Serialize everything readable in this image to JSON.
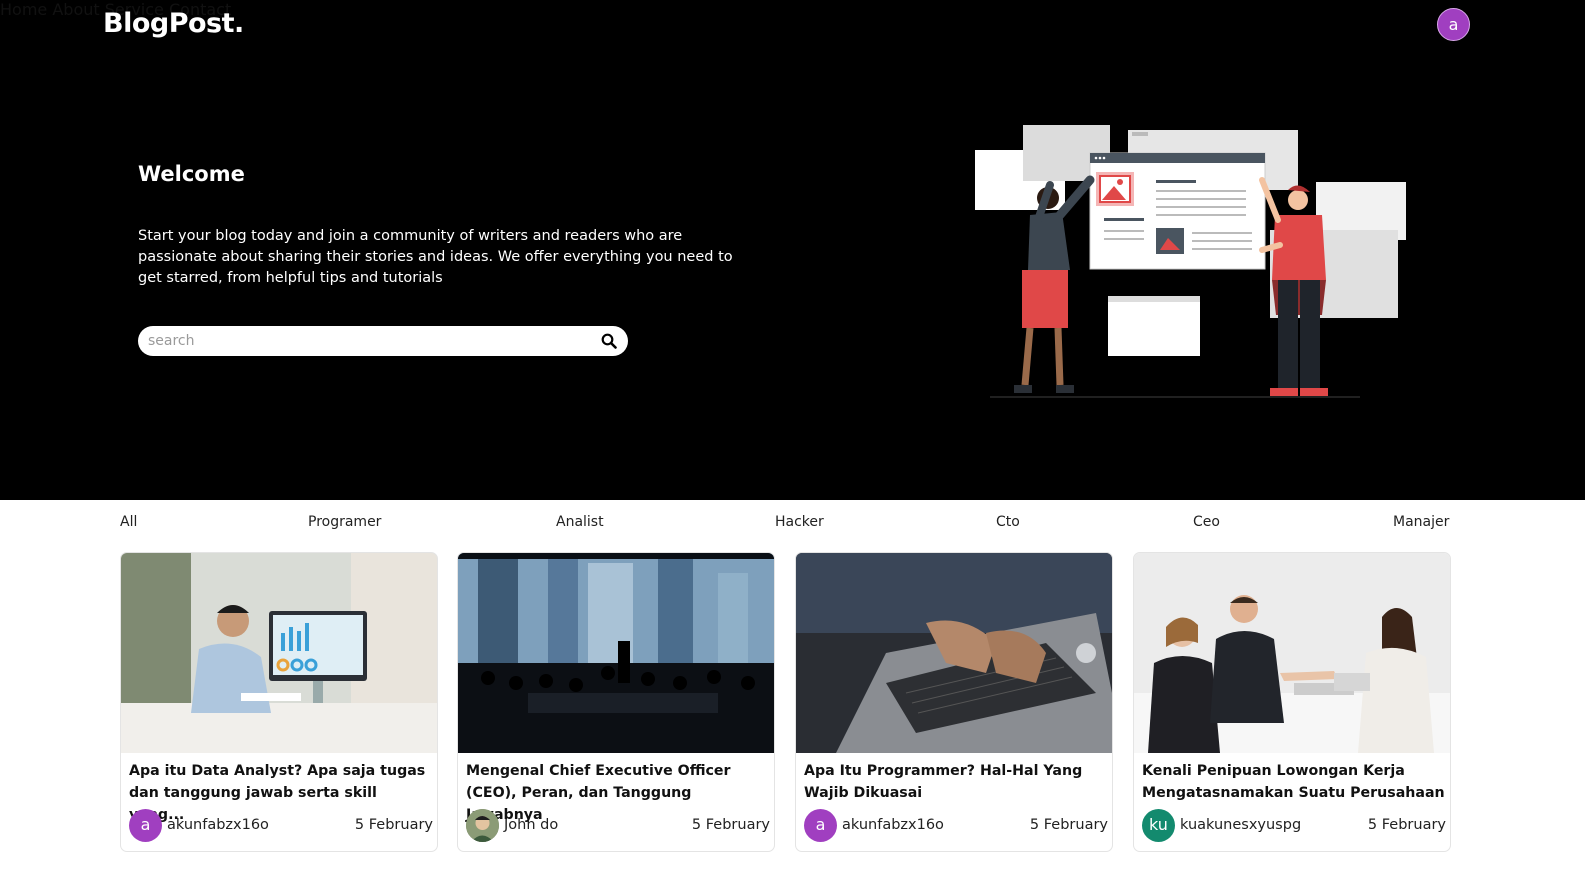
{
  "brand": {
    "logo": "BlogPost."
  },
  "nav": {
    "items": [
      "Home",
      "About",
      "Service",
      "Contact"
    ],
    "avatar_letter": "a",
    "avatar_color": "#a03fc0"
  },
  "hero": {
    "heading": "Welcome",
    "intro": "Start your blog today and join a community of writers and readers who are passionate about sharing their stories and ideas. We offer everything you need to get starred, from helpful tips and tutorials",
    "search": {
      "placeholder": "search",
      "value": "",
      "icon": "search-icon"
    },
    "illustration": "two-people-arranging-web-layout-illustration"
  },
  "categories": [
    "All",
    "Programer",
    "Analist",
    "Hacker",
    "Cto",
    "Ceo",
    "Manajer"
  ],
  "posts": [
    {
      "title": "Apa itu Data Analyst? Apa saja tugas dan tanggung jawab serta skill yang...",
      "author": "akunfabzx16o",
      "avatar_letter": "a",
      "avatar_color": "#a03fc0",
      "date": "5 February",
      "thumbnail": "man-analyzing-charts-on-monitor"
    },
    {
      "title": "Mengenal Chief Executive Officer (CEO), Peran, dan Tanggung Jawabnya",
      "author": "John do",
      "avatar_letter": "",
      "avatar_color": "#6b7b5a",
      "date": "5 February",
      "thumbnail": "boardroom-silhouettes-city-view"
    },
    {
      "title": "Apa Itu Programmer? Hal-Hal Yang Wajib Dikuasai",
      "author": "akunfabzx16o",
      "avatar_letter": "a",
      "avatar_color": "#a03fc0",
      "date": "5 February",
      "thumbnail": "hands-typing-on-laptop"
    },
    {
      "title": "Kenali Penipuan Lowongan Kerja Mengatasnamakan Suatu Perusahaan",
      "author": "kuakunesxyuspg",
      "avatar_letter": "ku",
      "avatar_color": "#138a6e",
      "date": "5 February",
      "thumbnail": "business-handshake-meeting"
    }
  ]
}
